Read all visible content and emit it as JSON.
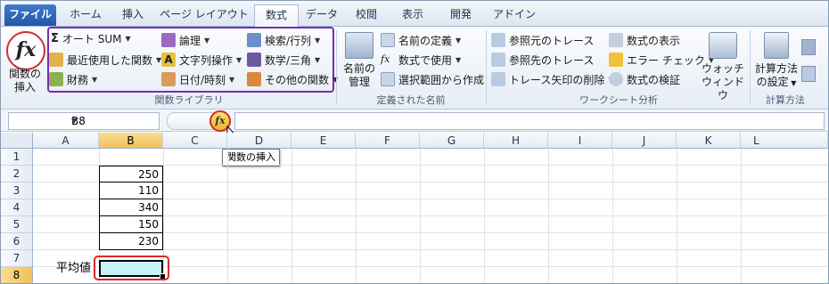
{
  "tabs": [
    "ファイル",
    "ホーム",
    "挿入",
    "ページ レイアウト",
    "数式",
    "データ",
    "校閲",
    "表示",
    "開発",
    "アドイン"
  ],
  "ribbon": {
    "insert_function": {
      "line1": "関数の",
      "line2": "挿入"
    },
    "function_library": {
      "autosum": "オート SUM",
      "recent": "最近使用した関数",
      "financial": "財務",
      "logical": "論理",
      "text": "文字列操作",
      "datetime": "日付/時刻",
      "lookup": "検索/行列",
      "math": "数学/三角",
      "more": "その他の関数",
      "label": "関数ライブラリ"
    },
    "defined_names": {
      "manager_line1": "名前の",
      "manager_line2": "管理",
      "define": "名前の定義",
      "use": "数式で使用",
      "create": "選択範囲から作成",
      "label": "定義された名前"
    },
    "auditing": {
      "precedents": "参照元のトレース",
      "dependents": "参照先のトレース",
      "remove_arrows": "トレース矢印の削除",
      "show_formulas": "数式の表示",
      "error_check": "エラー チェック",
      "evaluate": "数式の検証",
      "watch_line1": "ウォッチ",
      "watch_line2": "ウィンドウ",
      "label": "ワークシート分析"
    },
    "calculation": {
      "options_line1": "計算方法",
      "options_line2": "の設定",
      "label": "計算方法"
    }
  },
  "formula_bar": {
    "name_box": "B8",
    "fx": "fx",
    "tooltip": "関数の挿入"
  },
  "sheet": {
    "columns": [
      "A",
      "B",
      "C",
      "D",
      "E",
      "F",
      "G",
      "H",
      "I",
      "J",
      "K",
      "L"
    ],
    "rows": [
      "1",
      "2",
      "3",
      "4",
      "5",
      "6",
      "7",
      "8"
    ],
    "values": [
      "250",
      "110",
      "340",
      "150",
      "230"
    ],
    "label_a8": "平均値"
  },
  "colors": {
    "accent_red": "#d32b2b",
    "accent_purple": "#7a2bb3",
    "active_fill": "#c8f1f8"
  }
}
